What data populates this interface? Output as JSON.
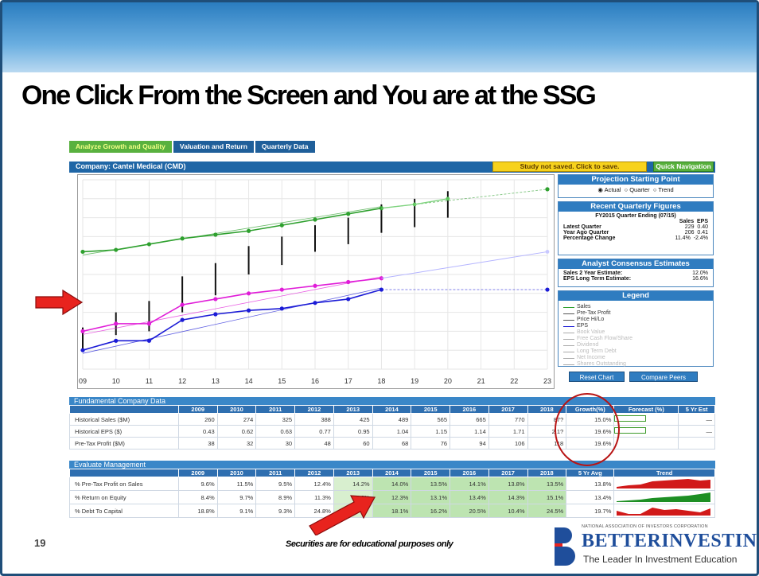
{
  "slide": {
    "title": "One Click From the Screen and You are at the SSG",
    "page_number": "19",
    "footer_note": "Securities are for educational purposes only"
  },
  "tabs": [
    "Analyze Growth and Quality",
    "Valuation and Return",
    "Quarterly Data"
  ],
  "company_label": "Company: Cantel Medical (CMD)",
  "buttons": {
    "study": "Study not saved. Click to save.",
    "quick_nav": "Quick Navigation",
    "reset_chart": "Reset Chart",
    "compare_peers": "Compare Peers"
  },
  "projection": {
    "header": "Projection Starting Point",
    "options": [
      "Actual",
      "Quarter",
      "Trend"
    ]
  },
  "recent_quarterly": {
    "header": "Recent Quarterly Figures",
    "subtitle": "FY2015 Quarter Ending (07/15)",
    "col_sales": "Sales",
    "col_eps": "EPS",
    "rows": [
      {
        "label": "Latest Quarter",
        "sales": "229",
        "eps": "0.40"
      },
      {
        "label": "Year Ago Quarter",
        "sales": "206",
        "eps": "0.41"
      },
      {
        "label": "Percentage Change",
        "sales": "11.4%",
        "eps": "-2.4%"
      }
    ]
  },
  "analyst": {
    "header": "Analyst Consensus Estimates",
    "rows": [
      {
        "label": "Sales 2 Year Estimate:",
        "value": "12.0%"
      },
      {
        "label": "EPS Long Term Estimate:",
        "value": "16.6%"
      }
    ]
  },
  "legend": {
    "header": "Legend",
    "items": [
      {
        "label": "Sales",
        "color": "#2ea02e",
        "faded": false
      },
      {
        "label": "Pre-Tax Profit",
        "color": "#555555",
        "faded": false
      },
      {
        "label": "Price Hi/Lo",
        "color": "#555555",
        "faded": false
      },
      {
        "label": "EPS",
        "color": "#1b1bd6",
        "faded": false
      },
      {
        "label": "Book Value",
        "color": "#aaaaaa",
        "faded": true
      },
      {
        "label": "Free Cash Flow/Share",
        "color": "#aaaaaa",
        "faded": true
      },
      {
        "label": "Dividend",
        "color": "#aaaaaa",
        "faded": true
      },
      {
        "label": "Long Term Debt",
        "color": "#aaaaaa",
        "faded": true
      },
      {
        "label": "Net Income",
        "color": "#aaaaaa",
        "faded": true
      },
      {
        "label": "Shares Outstanding",
        "color": "#aaaaaa",
        "faded": true
      }
    ]
  },
  "chart_data": {
    "type": "line",
    "x": [
      "09",
      "10",
      "11",
      "12",
      "13",
      "14",
      "15",
      "16",
      "17",
      "18",
      "19",
      "20",
      "21",
      "22",
      "23"
    ],
    "series": [
      {
        "name": "Sales",
        "color": "#2ea02e",
        "values": [
          0.62,
          0.63,
          0.66,
          0.69,
          0.71,
          0.73,
          0.76,
          0.79,
          0.82,
          0.85,
          0.87,
          0.9,
          null,
          null,
          0.95
        ]
      },
      {
        "name": "Pre-Tax Profit",
        "color": "#e01cd8",
        "values": [
          0.2,
          0.24,
          0.24,
          0.34,
          0.37,
          0.4,
          0.42,
          0.44,
          0.46,
          0.48,
          null,
          null,
          null,
          null,
          null
        ]
      },
      {
        "name": "EPS",
        "color": "#1b1bd6",
        "values": [
          0.1,
          0.15,
          0.15,
          0.26,
          0.29,
          0.31,
          0.32,
          0.35,
          0.37,
          0.42,
          null,
          null,
          null,
          null,
          0.42
        ]
      }
    ],
    "price_hi_lo": [
      [
        0.1,
        0.22
      ],
      [
        0.18,
        0.3
      ],
      [
        0.2,
        0.36
      ],
      [
        0.3,
        0.49
      ],
      [
        0.39,
        0.56
      ],
      [
        0.5,
        0.65
      ],
      [
        0.55,
        0.7
      ],
      [
        0.62,
        0.76
      ],
      [
        0.66,
        0.8
      ],
      [
        0.72,
        0.87
      ],
      [
        0.75,
        0.9
      ],
      [
        0.8,
        0.94
      ]
    ]
  },
  "fundamental": {
    "header": "Fundamental Company Data",
    "years": [
      "2009",
      "2010",
      "2011",
      "2012",
      "2013",
      "2014",
      "2015",
      "2016",
      "2017",
      "2018"
    ],
    "extra_cols": [
      "Growth(%)",
      "Forecast (%)",
      "5 Yr Est"
    ],
    "rows": [
      {
        "label": "Historical Sales ($M)",
        "values": [
          "260",
          "274",
          "325",
          "388",
          "425",
          "489",
          "565",
          "665",
          "770",
          "87?"
        ],
        "growth": "15.0%",
        "forecast": true,
        "est": "—"
      },
      {
        "label": "Historical EPS ($)",
        "values": [
          "0.43",
          "0.62",
          "0.63",
          "0.77",
          "0.95",
          "1.04",
          "1.15",
          "1.14",
          "1.71",
          "2.1?"
        ],
        "growth": "19.6%",
        "forecast": true,
        "est": "—"
      },
      {
        "label": "Pre-Tax Profit ($M)",
        "values": [
          "38",
          "32",
          "30",
          "48",
          "60",
          "68",
          "76",
          "94",
          "106",
          "118"
        ],
        "growth": "19.6%",
        "forecast": false,
        "est": ""
      }
    ]
  },
  "management": {
    "header": "Evaluate Management",
    "years": [
      "2009",
      "2010",
      "2011",
      "2012",
      "2013",
      "2014",
      "2015",
      "2016",
      "2017",
      "2018"
    ],
    "extra_cols": [
      "5 Yr Avg",
      "Trend"
    ],
    "rows": [
      {
        "label": "% Pre-Tax Profit on Sales",
        "values": [
          "9.6%",
          "11.5%",
          "9.5%",
          "12.4%",
          "14.2%",
          "14.0%",
          "13.5%",
          "14.1%",
          "13.8%",
          "13.5%"
        ],
        "avg": "13.8%"
      },
      {
        "label": "% Return on Equity",
        "values": [
          "8.4%",
          "9.7%",
          "8.9%",
          "11.3%",
          "12.?%",
          "12.3%",
          "13.1%",
          "13.4%",
          "14.3%",
          "15.1%"
        ],
        "avg": "13.4%"
      },
      {
        "label": "% Debt To Capital",
        "values": [
          "18.8%",
          "9.1%",
          "9.3%",
          "24.8%",
          "",
          "18.1%",
          "16.2%",
          "20.5%",
          "10.4%",
          "24.5%"
        ],
        "avg": "19.7%"
      }
    ]
  },
  "logo": {
    "org": "NATIONAL ASSOCIATION OF INVESTORS CORPORATION",
    "brand": "BETTERINVESTING",
    "tagline": "The Leader In Investment Education"
  }
}
